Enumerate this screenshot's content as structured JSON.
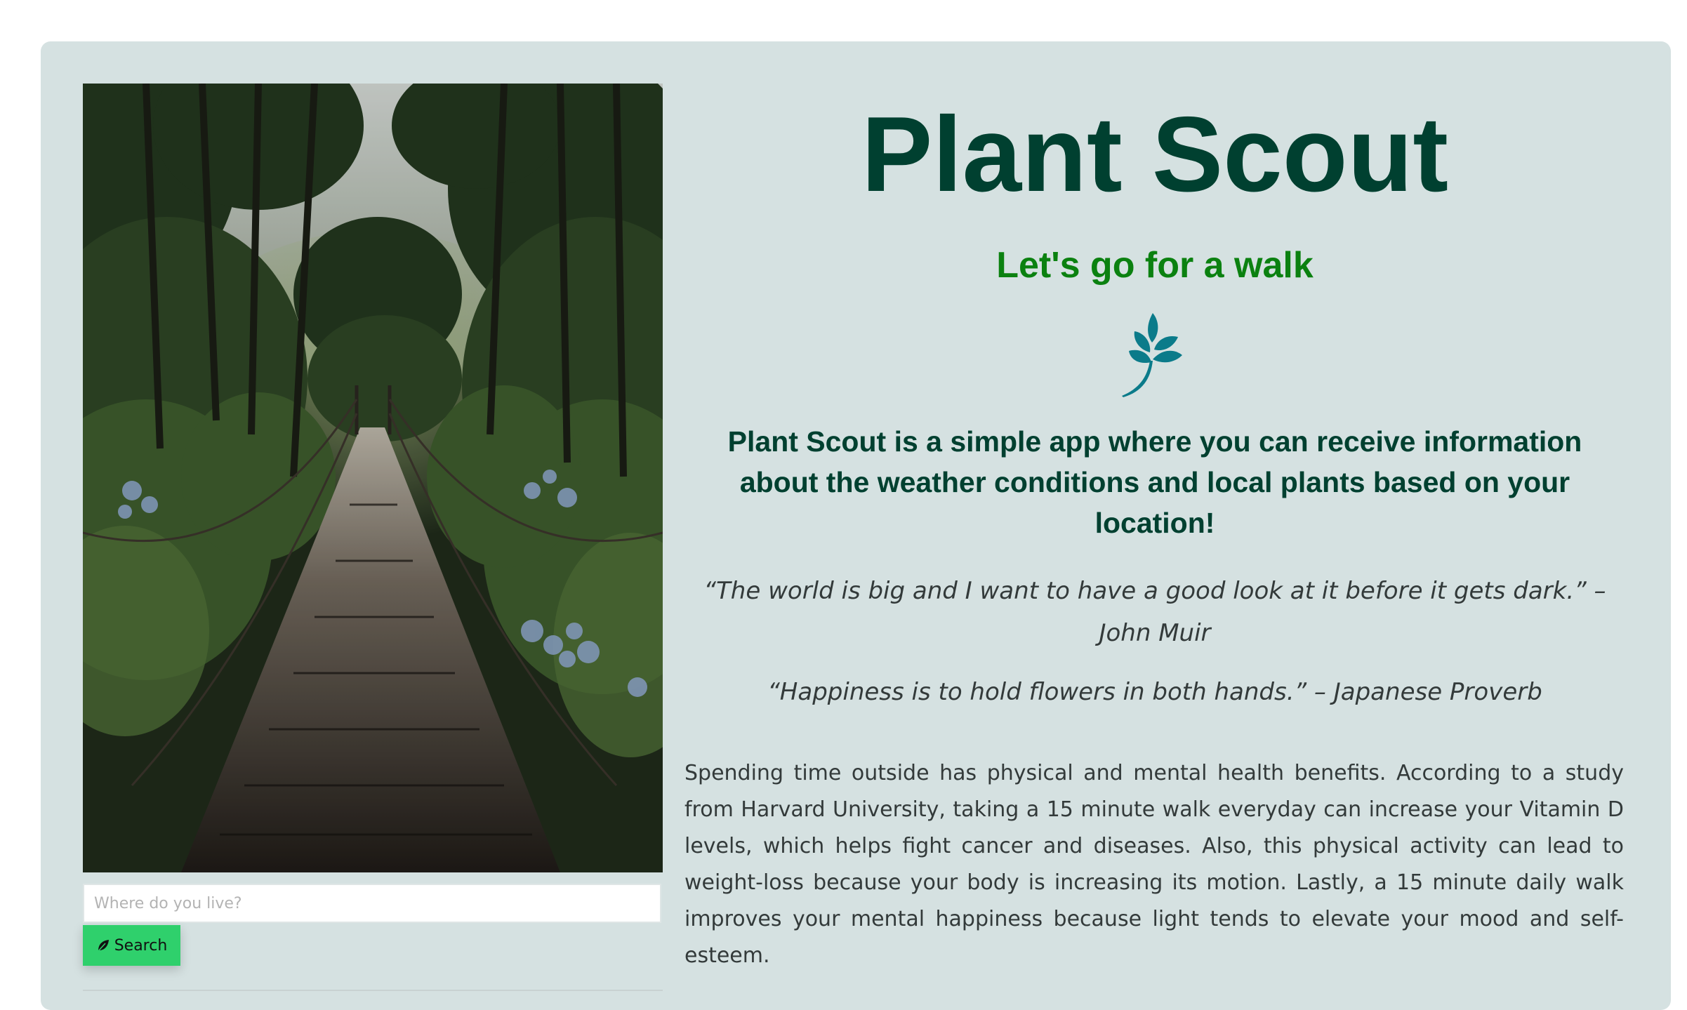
{
  "hero": {
    "title": "Plant Scout",
    "subtitle": "Let's go for a walk",
    "icon": "leaf-icon",
    "icon_color": "#0b7b8a",
    "intro": "Plant Scout is a simple app where you can receive information about the weather conditions and local plants based on your location!"
  },
  "quotes": [
    "“The world is big and I want to have a good look at it before it gets dark.” – John Muir",
    "“Happiness is to hold flowers in both hands.” – Japanese Proverb"
  ],
  "body": {
    "paragraph": "Spending time outside has physical and mental health benefits. According to a study from Harvard University, taking a 15 minute walk everyday can increase your Vitamin D levels, which helps fight cancer and diseases. Also, this physical activity can lead to weight-loss because your body is increasing its motion. Lastly, a 15 minute daily walk improves your mental happiness because light tends to elevate your mood and self-esteem."
  },
  "search": {
    "placeholder": "Where do you live?",
    "value": "",
    "button_label": "Search",
    "button_icon": "leaf-icon",
    "button_color": "#2fd06c"
  },
  "photo": {
    "subject": "forest-suspension-bridge-photo"
  },
  "colors": {
    "card_background": "#d5e1e1",
    "title": "#004030",
    "subtitle": "#0b8110",
    "body_text": "#333a3a"
  }
}
